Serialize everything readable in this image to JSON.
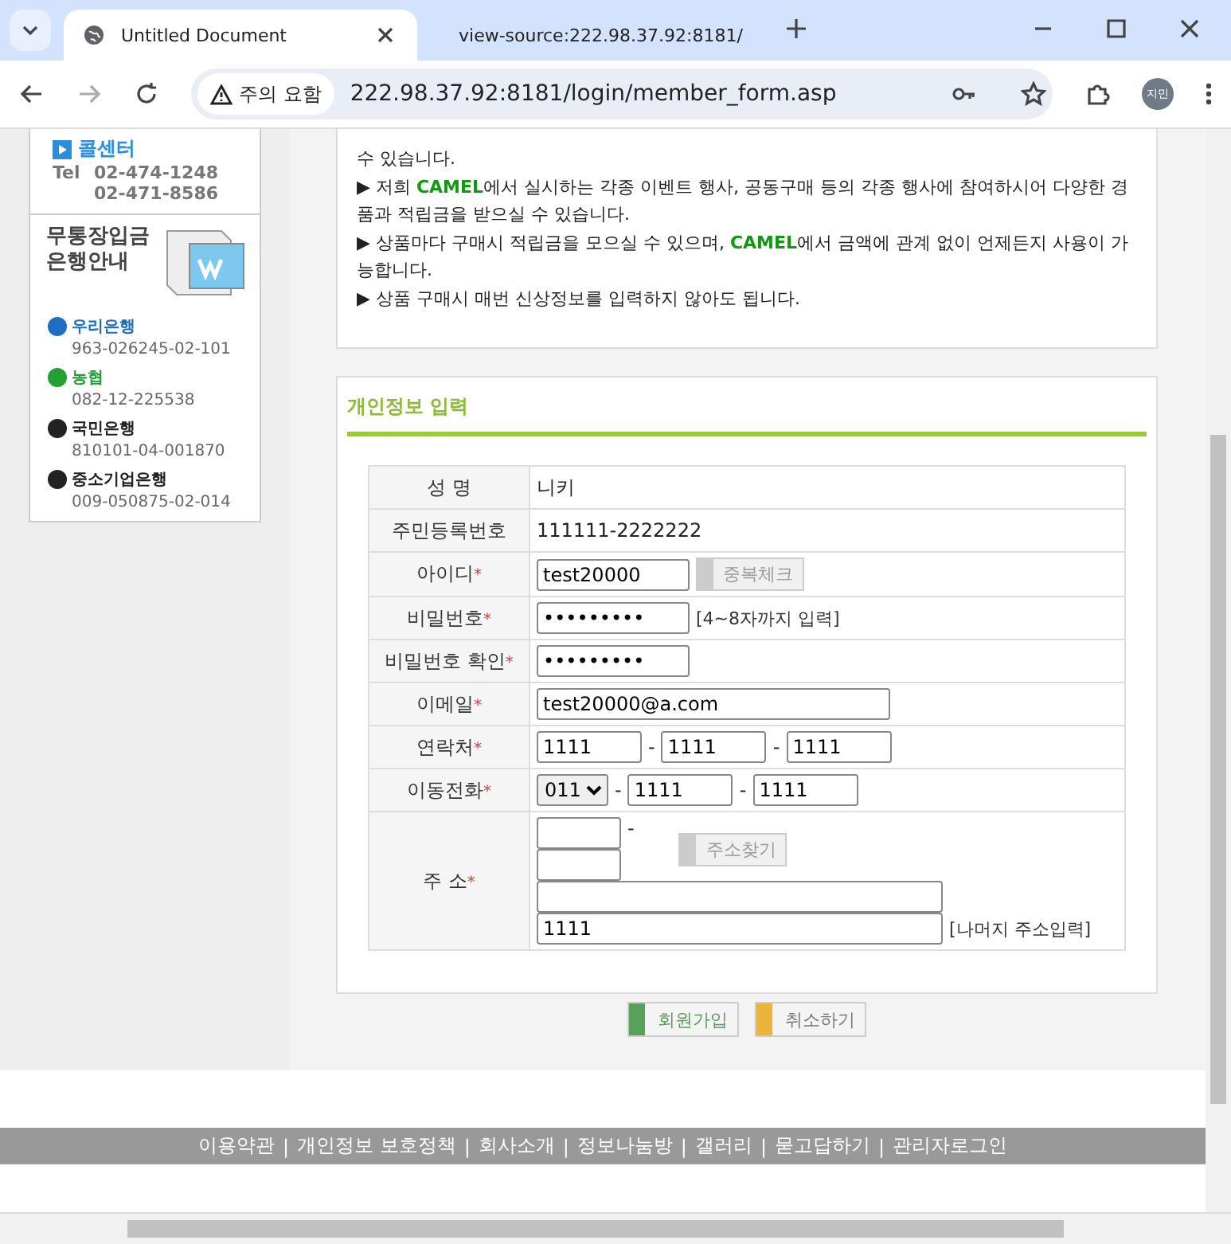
{
  "browser": {
    "tabs": [
      {
        "title": "Untitled Document",
        "selected": true
      },
      {
        "title": "view-source:222.98.37.92:8181/",
        "selected": false
      }
    ],
    "security_label": "주의 요함",
    "url": "222.98.37.92:8181/login/member_form.asp",
    "profile": "지민"
  },
  "sidebar": {
    "call_center": "콜센터",
    "tel_label": "Tel",
    "phones": [
      "02-474-1248",
      "02-471-8586"
    ],
    "bank_heading": [
      "무통장입금",
      "은행안내"
    ],
    "banks": [
      {
        "name": "우리은행",
        "account": "963-026245-02-101",
        "color": "#1e6fc4"
      },
      {
        "name": "농협",
        "account": "082-12-225538",
        "color": "#22a032"
      },
      {
        "name": "국민은행",
        "account": "810101-04-001870",
        "color": "#222222"
      },
      {
        "name": "중소기업은행",
        "account": "009-050875-02-014",
        "color": "#222222"
      }
    ]
  },
  "notice": [
    {
      "parts": [
        {
          "text": "수 있습니다.",
          "kind": "plain"
        }
      ]
    },
    {
      "bullet": "▶",
      "parts": [
        {
          "text": "저희 ",
          "kind": "plain"
        },
        {
          "text": "CAMEL",
          "kind": "brand"
        },
        {
          "text": "에서 실시하는 각종 이벤트 행사, 공동구매 등의 각종 행사에 참여하시어 다양한 경품과 적립금을 받으실 수 있습니다.",
          "kind": "plain"
        }
      ]
    },
    {
      "bullet": "▶",
      "parts": [
        {
          "text": "상품마다 구매시 적립금을 모으실 수 있으며, ",
          "kind": "plain"
        },
        {
          "text": "CAMEL",
          "kind": "brand"
        },
        {
          "text": "에서 금액에 관계 없이 언제든지 사용이 가능합니다.",
          "kind": "plain"
        }
      ]
    },
    {
      "bullet": "▶",
      "parts": [
        {
          "text": "상품 구매시 매번 신상정보를 입력하지 않아도 됩니다.",
          "kind": "plain"
        }
      ]
    }
  ],
  "form": {
    "title": "개인정보 입력",
    "required_mark": "*",
    "rows": [
      {
        "label": "성 명",
        "required": false,
        "kind": "text",
        "value": "니키"
      },
      {
        "label": "주민등록번호",
        "required": false,
        "kind": "text",
        "value": "111111-2222222"
      },
      {
        "label": "아이디",
        "required": true,
        "kind": "check",
        "value": "test20000",
        "button": "중복체크"
      },
      {
        "label": "비밀번호",
        "required": true,
        "kind": "password",
        "value": "•••••••••",
        "hint": "[4~8자까지 입력]"
      },
      {
        "label": "비밀번호 확인",
        "required": true,
        "kind": "password",
        "value": "•••••••••"
      },
      {
        "label": "이메일",
        "required": true,
        "kind": "email",
        "value": "test20000@a.com"
      },
      {
        "label": "연락처",
        "required": true,
        "kind": "phone",
        "values": [
          "1111",
          "1111",
          "1111"
        ],
        "separator": "-"
      },
      {
        "label": "이동전화",
        "required": true,
        "kind": "mobile",
        "select": "011",
        "values": [
          "1111",
          "1111"
        ],
        "separator": "-"
      },
      {
        "label": "주 소",
        "required": true,
        "kind": "address",
        "separator": "-",
        "button": "주소찾기",
        "detail": "1111",
        "hint": "[나머지 주소입력]"
      }
    ]
  },
  "buttons": [
    {
      "label": "회원가입",
      "kind": "join"
    },
    {
      "label": "취소하기",
      "kind": "cancel"
    }
  ],
  "footer": {
    "links": [
      "이용약관",
      "개인정보 보호정책",
      "회사소개",
      "정보나눔방",
      "갤러리",
      "묻고답하기",
      "관리자로그인"
    ],
    "separator": "|"
  }
}
